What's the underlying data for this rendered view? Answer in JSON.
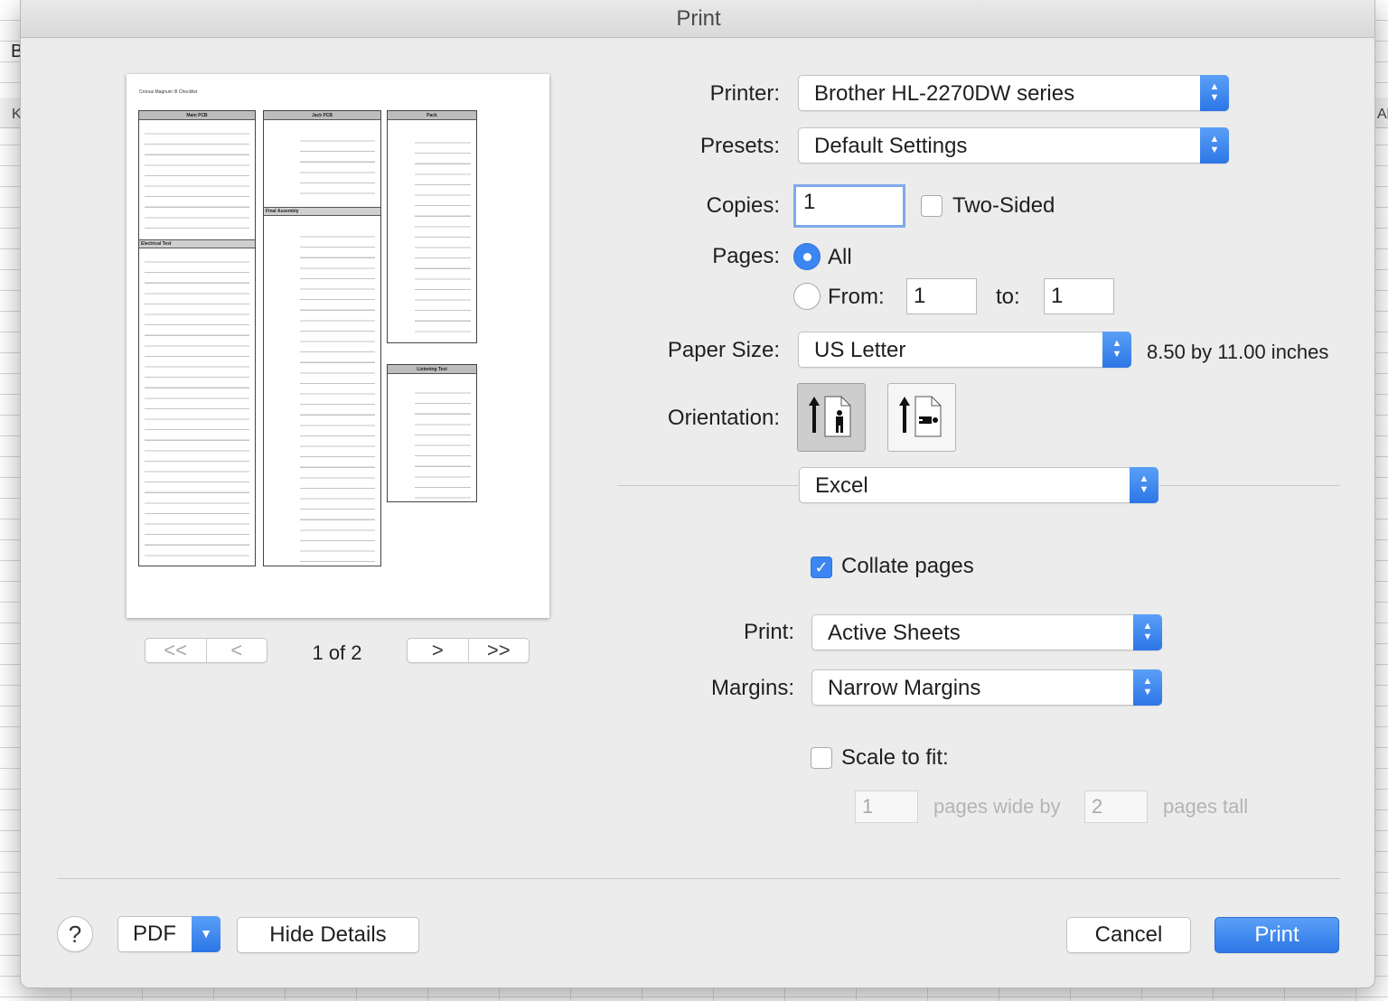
{
  "background": {
    "letter_b": "B",
    "col_k": "K",
    "col_al": "Al"
  },
  "dialog": {
    "title": "Print"
  },
  "preview": {
    "doc_title": "Cronus Magnum III Checklist",
    "box_main_pcb": "Main PCB",
    "box_jack_pcb": "Jack PCB",
    "box_pack": "Pack",
    "box_listening": "Listening Test",
    "sub_electrical": "Electrical Test",
    "sub_final": "Final Assembly",
    "page_counter": "1 of 2",
    "nav_first": "<<",
    "nav_prev": "<",
    "nav_next": ">",
    "nav_last": ">>"
  },
  "printer": {
    "label": "Printer:",
    "value": "Brother HL-2270DW series"
  },
  "presets": {
    "label": "Presets:",
    "value": "Default Settings"
  },
  "copies": {
    "label": "Copies:",
    "value": "1",
    "two_sided_label": "Two-Sided",
    "two_sided_checked": false
  },
  "pages": {
    "label": "Pages:",
    "all_label": "All",
    "from_label": "From:",
    "from_value": "1",
    "to_label": "to:",
    "to_value": "1",
    "selected": "all"
  },
  "paper_size": {
    "label": "Paper Size:",
    "value": "US Letter",
    "dimensions": "8.50 by 11.00 inches"
  },
  "orientation": {
    "label": "Orientation:",
    "selected": "portrait"
  },
  "section": {
    "value": "Excel"
  },
  "collate": {
    "label": "Collate pages",
    "checked": true
  },
  "print_what": {
    "label": "Print:",
    "value": "Active Sheets"
  },
  "margins": {
    "label": "Margins:",
    "value": "Narrow Margins"
  },
  "scale": {
    "label": "Scale to fit:",
    "checked": false,
    "wide_value": "1",
    "wide_label": "pages wide by",
    "tall_value": "2",
    "tall_label": "pages tall"
  },
  "footer": {
    "help_label": "?",
    "pdf_label": "PDF",
    "hide_details_label": "Hide Details",
    "cancel_label": "Cancel",
    "print_label": "Print"
  },
  "colors": {
    "accent": "#3b86f2",
    "dialog_bg": "#ececec"
  }
}
